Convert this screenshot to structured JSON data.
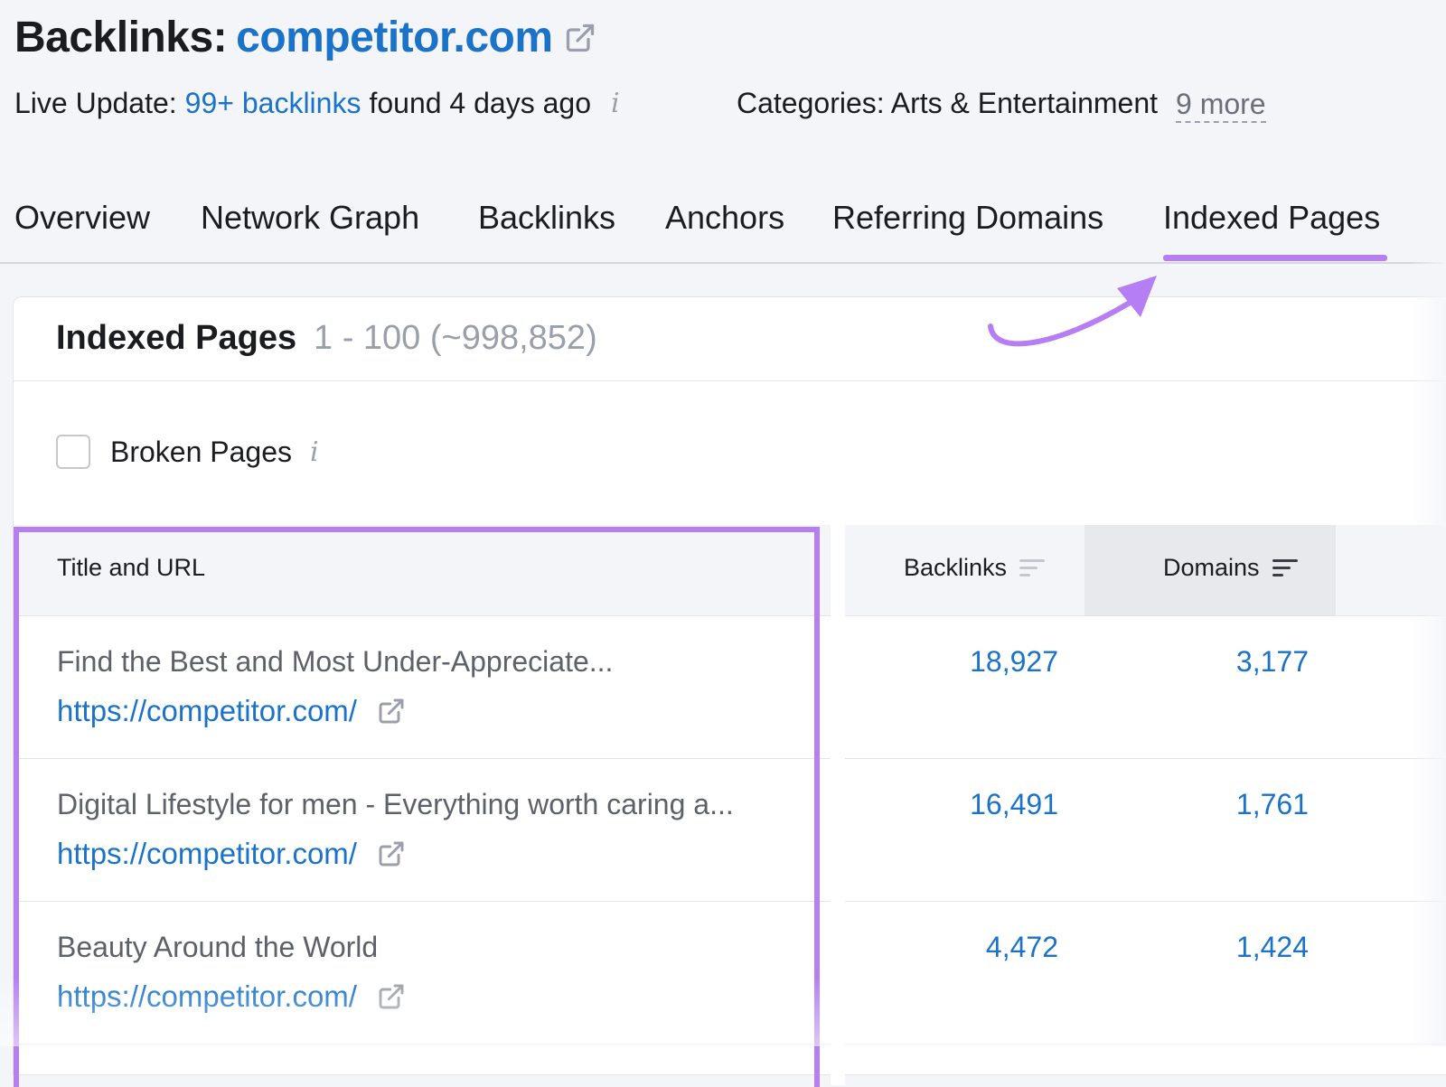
{
  "header": {
    "title_prefix": "Backlinks:",
    "domain": "competitor.com",
    "live_label": "Live Update:",
    "backlinks_count": "99+ backlinks",
    "found_text": "found 4 days ago",
    "categories_label": "Categories: Arts & Entertainment",
    "more_link": "9 more"
  },
  "tabs": [
    {
      "label": "Overview"
    },
    {
      "label": "Network Graph"
    },
    {
      "label": "Backlinks"
    },
    {
      "label": "Anchors"
    },
    {
      "label": "Referring Domains"
    },
    {
      "label": "Indexed Pages",
      "active": true
    }
  ],
  "card": {
    "title": "Indexed Pages",
    "count": "1 - 100 (~998,852)",
    "filter_label": "Broken Pages",
    "filter_checked": false
  },
  "table": {
    "columns": [
      "Title and URL",
      "Backlinks",
      "Domains"
    ],
    "rows": [
      {
        "title": "Find the Best and Most Under-Appreciate...",
        "url": "https://competitor.com/",
        "backlinks": "18,927",
        "domains": "3,177"
      },
      {
        "title": "Digital Lifestyle for men - Everything worth caring a...",
        "url": "https://competitor.com/",
        "backlinks": "16,491",
        "domains": "1,761"
      },
      {
        "title": "Beauty Around the World",
        "url": "https://competitor.com/",
        "backlinks": "4,472",
        "domains": "1,424"
      }
    ]
  },
  "colors": {
    "accent": "#b57ef3",
    "link": "#1a73c8"
  }
}
